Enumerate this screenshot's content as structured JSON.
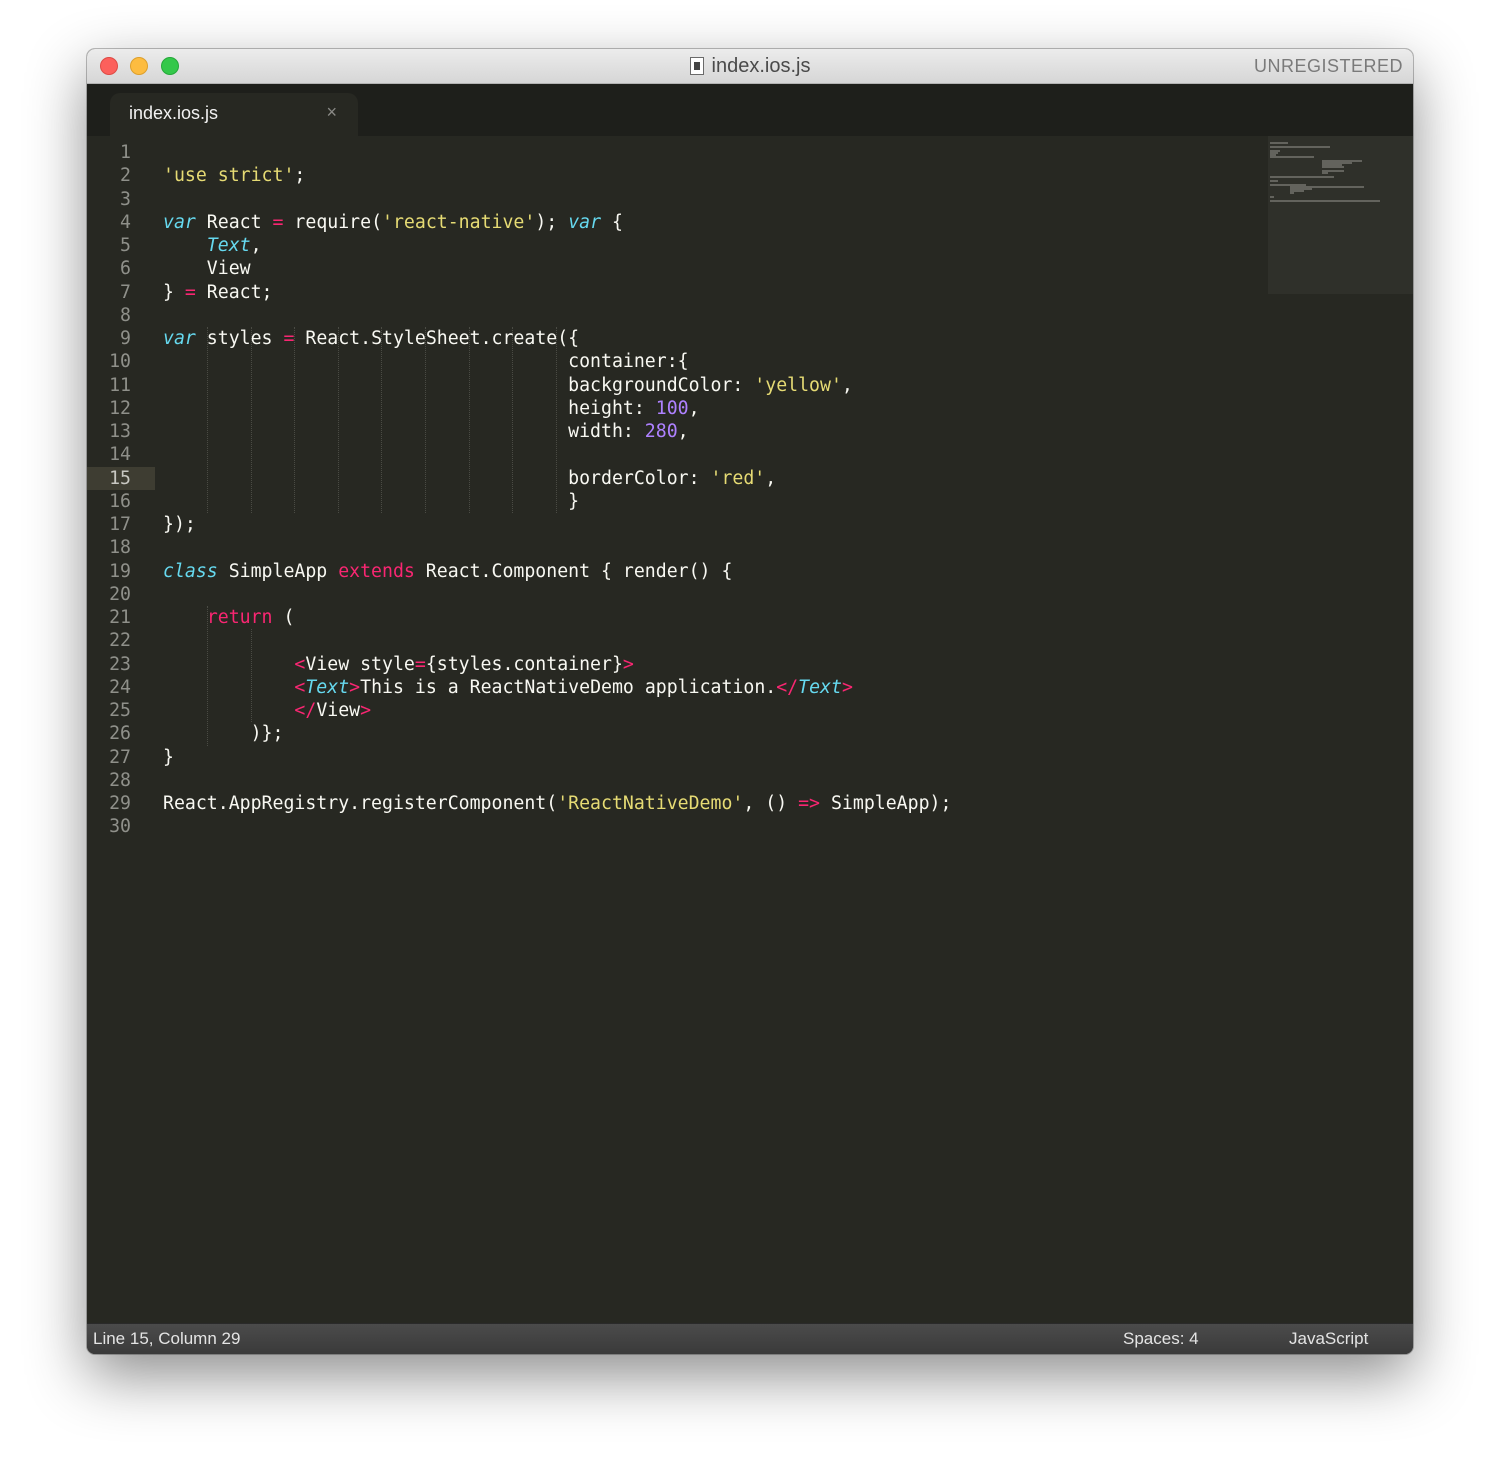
{
  "window": {
    "title": "index.ios.js",
    "registration": "UNREGISTERED",
    "icon": "document-icon"
  },
  "tabs": [
    {
      "label": "index.ios.js",
      "close_glyph": "×"
    }
  ],
  "editor": {
    "current_line": 15,
    "lines": [
      {
        "n": "1",
        "tokens": []
      },
      {
        "n": "2",
        "tokens": [
          [
            "str",
            "'use strict'"
          ],
          [
            "t",
            ";"
          ]
        ]
      },
      {
        "n": "3",
        "tokens": []
      },
      {
        "n": "4",
        "tokens": [
          [
            "kw",
            "var"
          ],
          [
            "t",
            " React "
          ],
          [
            "op",
            "="
          ],
          [
            "t",
            " require("
          ],
          [
            "str",
            "'react-native'"
          ],
          [
            "t",
            "); "
          ],
          [
            "kw",
            "var"
          ],
          [
            "t",
            " {"
          ]
        ]
      },
      {
        "n": "5",
        "tokens": [
          [
            "t",
            "    "
          ],
          [
            "cls",
            "Text"
          ],
          [
            "t",
            ","
          ]
        ]
      },
      {
        "n": "6",
        "tokens": [
          [
            "t",
            "    View"
          ]
        ]
      },
      {
        "n": "7",
        "tokens": [
          [
            "t",
            "} "
          ],
          [
            "op",
            "="
          ],
          [
            "t",
            " React;"
          ]
        ]
      },
      {
        "n": "8",
        "tokens": []
      },
      {
        "n": "9",
        "tokens": [
          [
            "kw",
            "var"
          ],
          [
            "t",
            " styles "
          ],
          [
            "op",
            "="
          ],
          [
            "t",
            " React.StyleSheet.create({"
          ]
        ]
      },
      {
        "n": "10",
        "tokens": [
          [
            "t",
            "                                     container:{"
          ]
        ]
      },
      {
        "n": "11",
        "tokens": [
          [
            "t",
            "                                     backgroundColor: "
          ],
          [
            "str",
            "'yellow'"
          ],
          [
            "t",
            ","
          ]
        ]
      },
      {
        "n": "12",
        "tokens": [
          [
            "t",
            "                                     height: "
          ],
          [
            "num",
            "100"
          ],
          [
            "t",
            ","
          ]
        ]
      },
      {
        "n": "13",
        "tokens": [
          [
            "t",
            "                                     width: "
          ],
          [
            "num",
            "280"
          ],
          [
            "t",
            ","
          ]
        ]
      },
      {
        "n": "14",
        "tokens": []
      },
      {
        "n": "15",
        "tokens": [
          [
            "t",
            "                                     borderColor: "
          ],
          [
            "str",
            "'red'"
          ],
          [
            "t",
            ","
          ]
        ]
      },
      {
        "n": "16",
        "tokens": [
          [
            "t",
            "                                     }"
          ]
        ]
      },
      {
        "n": "17",
        "tokens": [
          [
            "t",
            "});"
          ]
        ]
      },
      {
        "n": "18",
        "tokens": []
      },
      {
        "n": "19",
        "tokens": [
          [
            "kw",
            "class"
          ],
          [
            "t",
            " SimpleApp "
          ],
          [
            "kw2",
            "extends"
          ],
          [
            "t",
            " React.Component { render() {"
          ]
        ]
      },
      {
        "n": "20",
        "tokens": []
      },
      {
        "n": "21",
        "tokens": [
          [
            "t",
            "    "
          ],
          [
            "kw2",
            "return"
          ],
          [
            "t",
            " ("
          ]
        ]
      },
      {
        "n": "22",
        "tokens": []
      },
      {
        "n": "23",
        "tokens": [
          [
            "t",
            "            "
          ],
          [
            "tag",
            "<"
          ],
          [
            "t",
            "View style"
          ],
          [
            "op",
            "="
          ],
          [
            "t",
            "{styles.container}"
          ],
          [
            "tag",
            ">"
          ]
        ]
      },
      {
        "n": "24",
        "tokens": [
          [
            "t",
            "            "
          ],
          [
            "tag",
            "<"
          ],
          [
            "cls",
            "Text"
          ],
          [
            "tag",
            ">"
          ],
          [
            "t",
            "This is a ReactNativeDemo application."
          ],
          [
            "tag",
            "</"
          ],
          [
            "cls",
            "Text"
          ],
          [
            "tag",
            ">"
          ]
        ]
      },
      {
        "n": "25",
        "tokens": [
          [
            "t",
            "            "
          ],
          [
            "tag",
            "</"
          ],
          [
            "t",
            "View"
          ],
          [
            "tag",
            ">"
          ]
        ]
      },
      {
        "n": "26",
        "tokens": [
          [
            "t",
            "        )};"
          ]
        ]
      },
      {
        "n": "27",
        "tokens": [
          [
            "t",
            "}"
          ]
        ]
      },
      {
        "n": "28",
        "tokens": []
      },
      {
        "n": "29",
        "tokens": [
          [
            "t",
            "React.AppRegistry.registerComponent("
          ],
          [
            "str",
            "'ReactNativeDemo'"
          ],
          [
            "t",
            ", () "
          ],
          [
            "op",
            "=>"
          ],
          [
            "t",
            " SimpleApp);"
          ]
        ]
      },
      {
        "n": "30",
        "tokens": []
      }
    ]
  },
  "status": {
    "position": "Line 15, Column 29",
    "indentation": "Spaces: 4",
    "syntax": "JavaScript"
  },
  "colors": {
    "background": "#272822",
    "keyword": "#66d9ef",
    "operator": "#f92672",
    "string": "#e6db74",
    "number": "#ae81ff",
    "text": "#f8f8f2"
  }
}
